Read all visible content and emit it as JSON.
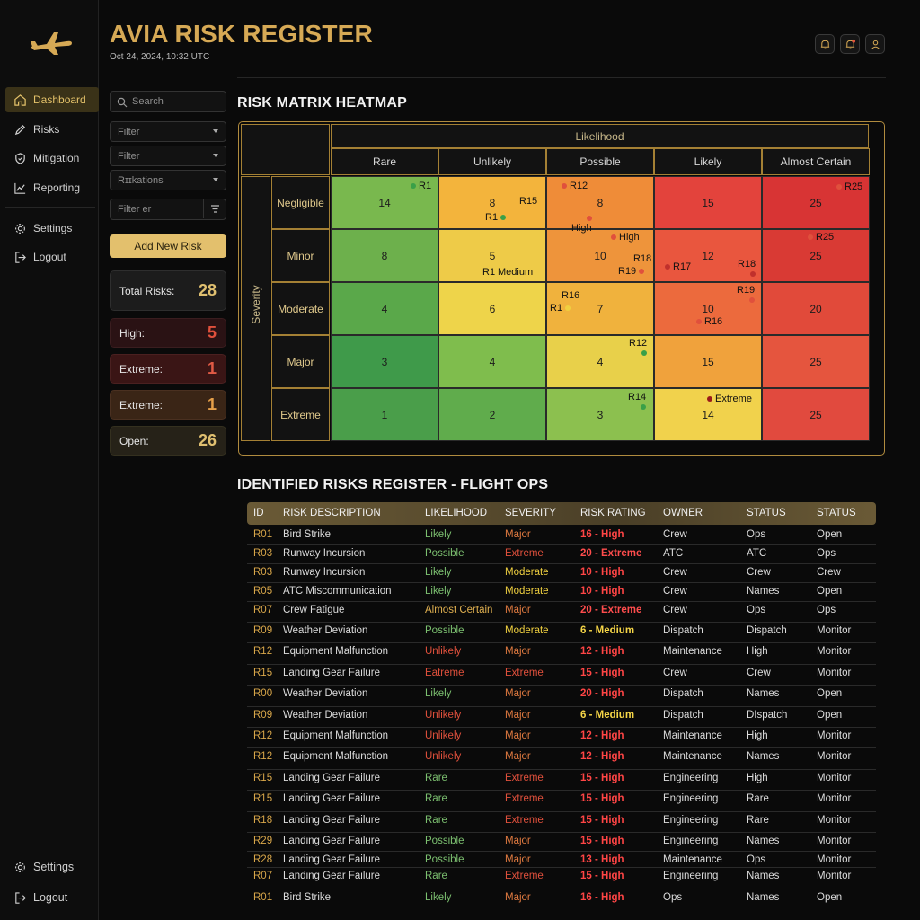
{
  "app": {
    "title": "AVIA RISK REGISTER",
    "timestamp": "Oct 24, 2024, 10:32 UTC"
  },
  "colors": {
    "gold": "#d6a955",
    "high": "#ff4d4d",
    "medium": "#f5d547",
    "green": "#7cc070",
    "extreme_text": "#e0503c",
    "major_text": "#e0703c",
    "moderate_text": "#f0d040"
  },
  "nav": {
    "top": [
      {
        "label": "Dashboard",
        "icon": "home-icon",
        "active": true
      },
      {
        "label": "Risks",
        "icon": "pencil-icon"
      },
      {
        "label": "Mitigation",
        "icon": "shield-icon"
      },
      {
        "label": "Reporting",
        "icon": "line-chart-icon"
      },
      {
        "label": "Settings",
        "icon": "gear-icon"
      },
      {
        "label": "Logout",
        "icon": "logout-icon"
      }
    ],
    "bottom": [
      {
        "label": "Settings",
        "icon": "gear-icon"
      },
      {
        "label": "Logout",
        "icon": "logout-icon"
      }
    ]
  },
  "filters": {
    "search_placeholder": "Search",
    "filter1": "Filter",
    "filter2": "Filter",
    "filter3": "Rɪɪkations",
    "filter4": "Filter er",
    "add_button": "Add New Risk"
  },
  "stats": [
    {
      "label": "Total Risks:",
      "value": "28",
      "kind": "total"
    },
    {
      "label": "High:",
      "value": "5",
      "kind": "high"
    },
    {
      "label": "Extreme:",
      "value": "1",
      "kind": "extreme"
    },
    {
      "label": "Extreme:",
      "value": "1",
      "kind": "extreme2"
    },
    {
      "label": "Open:",
      "value": "26",
      "kind": "open"
    }
  ],
  "matrix": {
    "title": "RISK MATRIX HEATMAP",
    "x_axis": "Likelihood",
    "y_axis": "Severity",
    "columns": [
      "Rare",
      "Unlikely",
      "Possible",
      "Likely",
      "Almost Certain"
    ],
    "rows": [
      {
        "label": "Negligible",
        "values": [
          "14",
          "8",
          "8",
          "15",
          "25"
        ]
      },
      {
        "label": "Minor",
        "values": [
          "8",
          "5",
          "10",
          "12",
          "25"
        ]
      },
      {
        "label": "Moderate",
        "values": [
          "4",
          "6",
          "7",
          "10",
          "20"
        ]
      },
      {
        "label": "Major",
        "values": [
          "3",
          "4",
          "4",
          "15",
          "25"
        ]
      },
      {
        "label": "Extreme",
        "values": [
          "1",
          "2",
          "3",
          "14",
          "25"
        ]
      }
    ],
    "markers": [
      "R1",
      "R15",
      "R1",
      "R12",
      "High",
      "R25",
      "High",
      "R18",
      "R19",
      "R17",
      "R18",
      "R25",
      "R1",
      "Medium",
      "R16",
      "R1",
      "R19",
      "R16",
      "R12",
      "R14",
      "Extreme"
    ]
  },
  "register": {
    "title": "IDENTIFIED RISKS REGISTER - FLIGHT OPS",
    "headers": [
      "ID",
      "RISK DESCRIPTION",
      "LIKELIHOOD",
      "SEVERITY",
      "RISK RATING",
      "OWNER",
      "STATUS",
      "STATUS"
    ],
    "rows": [
      {
        "id": "R01",
        "desc": "Bird Strike",
        "lik": "Likely",
        "sev": "Major",
        "rating": "16 - High",
        "owner": "Crew",
        "s1": "Ops",
        "s2": "Open"
      },
      {
        "id": "R03",
        "desc": "Runway Incursion",
        "lik": "Possible",
        "sev": "Extreme",
        "rating": "20 - Extreme",
        "owner": "ATC",
        "s1": "ATC",
        "s2": "Ops"
      },
      {
        "id": "R03",
        "desc": "Runway Incursion",
        "lik": "Likely",
        "sev": "Moderate",
        "rating": "10 - High",
        "owner": "Crew",
        "s1": "Crew",
        "s2": "Crew"
      },
      {
        "id": "R05",
        "desc": "ATC Miscommunication",
        "lik": "Likely",
        "sev": "Moderate",
        "rating": "10 - High",
        "owner": "Crew",
        "s1": "Names",
        "s2": "Open"
      },
      {
        "id": "R07",
        "desc": "Crew Fatigue",
        "lik": "Almost Certain",
        "sev": "Major",
        "rating": "20 - Extreme",
        "owner": "Crew",
        "s1": "Ops",
        "s2": "Ops"
      },
      {
        "id": "R09",
        "desc": "Weather Deviation",
        "lik": "Possible",
        "sev": "Moderate",
        "rating": "6 - Medium",
        "owner": "Dispatch",
        "s1": "Dispatch",
        "s2": "Monitor"
      },
      {
        "id": "R12",
        "desc": "Equipment Malfunction",
        "lik": "Unlikely",
        "sev": "Major",
        "rating": "12 - High",
        "owner": "Maintenance",
        "s1": "High",
        "s2": "Monitor"
      },
      {
        "id": "R15",
        "desc": "Landing Gear Failure",
        "lik": "Eatreme",
        "sev": "Extreme",
        "rating": "15 - High",
        "owner": "Crew",
        "s1": "Crew",
        "s2": "Monitor"
      },
      {
        "id": "R00",
        "desc": "Weather Deviation",
        "lik": "Likely",
        "sev": "Major",
        "rating": "20 - High",
        "owner": "Dispatch",
        "s1": "Names",
        "s2": "Open"
      },
      {
        "id": "R09",
        "desc": "Weather Deviation",
        "lik": "Unlikely",
        "sev": "Major",
        "rating": "6 - Medium",
        "owner": "Dispatch",
        "s1": "DIspatch",
        "s2": "Open"
      },
      {
        "id": "R12",
        "desc": "Equipment Malfunction",
        "lik": "Unlikely",
        "sev": "Major",
        "rating": "12 - High",
        "owner": "Maintenance",
        "s1": "High",
        "s2": "Monitor"
      },
      {
        "id": "R12",
        "desc": "Equipment Malfunction",
        "lik": "Unlikely",
        "sev": "Major",
        "rating": "12 - High",
        "owner": "Maintenance",
        "s1": "Names",
        "s2": "Monitor"
      },
      {
        "id": "R15",
        "desc": "Landing Gear Failure",
        "lik": "Rare",
        "sev": "Extreme",
        "rating": "15 - High",
        "owner": "Engineering",
        "s1": "High",
        "s2": "Monitor"
      },
      {
        "id": "R15",
        "desc": "Landing Gear Failure",
        "lik": "Rare",
        "sev": "Extreme",
        "rating": "15 - High",
        "owner": "Engineering",
        "s1": "Rare",
        "s2": "Monitor"
      },
      {
        "id": "R18",
        "desc": "Landing Gear Failure",
        "lik": "Rare",
        "sev": "Extreme",
        "rating": "15 - High",
        "owner": "Engineering",
        "s1": "Rare",
        "s2": "Monitor"
      },
      {
        "id": "R29",
        "desc": "Landing Gear Failure",
        "lik": "Possible",
        "sev": "Major",
        "rating": "15 - High",
        "owner": "Engineering",
        "s1": "Names",
        "s2": "Monitor"
      },
      {
        "id": "R28",
        "desc": "Landing Gear Failure",
        "lik": "Possible",
        "sev": "Major",
        "rating": "13 - High",
        "owner": "Maintenance",
        "s1": "Ops",
        "s2": "Monitor"
      },
      {
        "id": "R07",
        "desc": "Landing Gear Failure",
        "lik": "Rare",
        "sev": "Extreme",
        "rating": "15 - High",
        "owner": "Engineering",
        "s1": "Names",
        "s2": "Monitor"
      },
      {
        "id": "R01",
        "desc": "Bird Strike",
        "lik": "Likely",
        "sev": "Major",
        "rating": "16 - High",
        "owner": "Ops",
        "s1": "Names",
        "s2": "Open"
      }
    ]
  }
}
